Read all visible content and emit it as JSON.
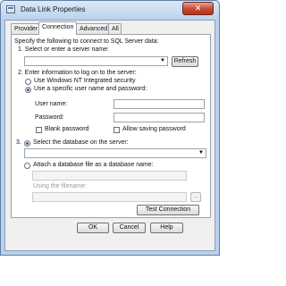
{
  "window": {
    "title": "Data Link Properties",
    "close_glyph": "✕"
  },
  "tabs": [
    {
      "label": "Provider",
      "active": false
    },
    {
      "label": "Connection",
      "active": true
    },
    {
      "label": "Advanced",
      "active": false
    },
    {
      "label": "All",
      "active": false
    }
  ],
  "connection": {
    "intro": "Specify the following to connect to SQL Server data:",
    "step1": "1. Select or enter a server name:",
    "server_value": "",
    "refresh_label": "Refresh",
    "step2": "2. Enter information to log on to the server:",
    "nt_security_label": "Use Windows NT Integrated security",
    "specific_user_label": "Use a specific user name and password:",
    "username_label": "User name:",
    "username_value": "",
    "password_label": "Password:",
    "password_value": "",
    "blank_password_label": "Blank password",
    "allow_saving_label": "Allow saving password",
    "step3_prefix": "3.",
    "select_db_label": "Select the database on the server:",
    "database_value": "",
    "attach_label": "Attach a database file as a database name:",
    "attach_value": "",
    "using_filename_label": "Using the filename:",
    "filename_value": "",
    "browse_label": "...",
    "test_connection_label": "Test Connection"
  },
  "footer": {
    "ok_label": "OK",
    "cancel_label": "Cancel",
    "help_label": "Help"
  },
  "icons": {
    "dropdown_arrow": "▼"
  }
}
